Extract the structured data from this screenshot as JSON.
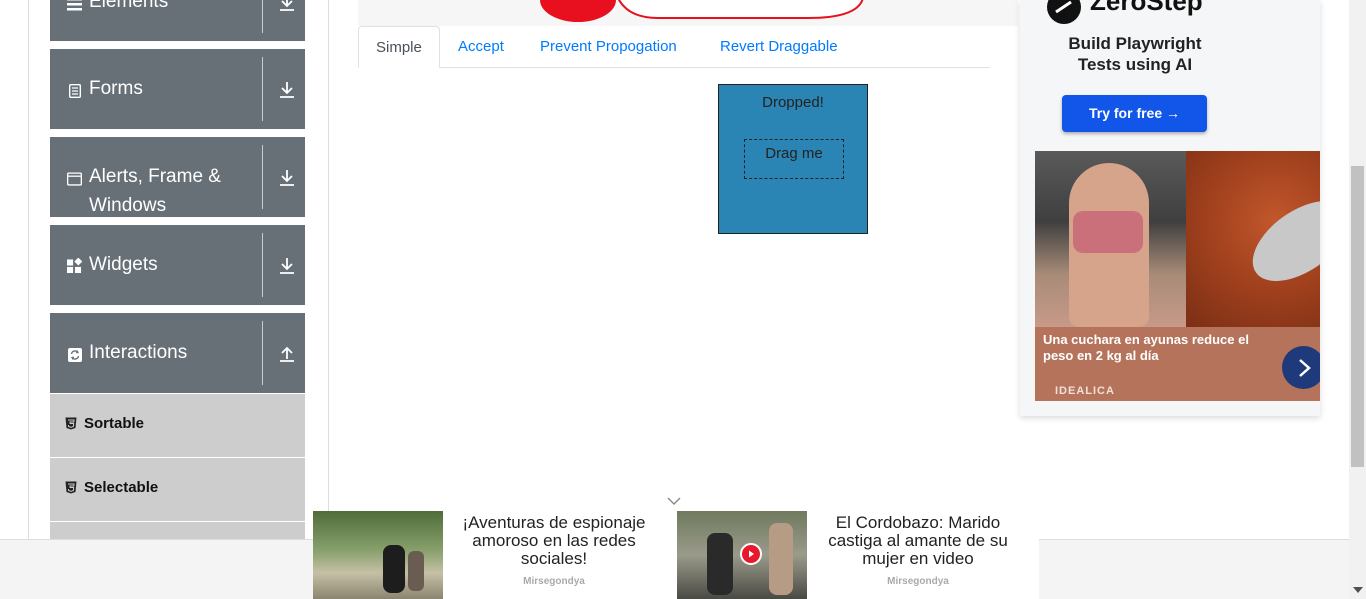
{
  "sidebar": {
    "groups": [
      {
        "label": "Elements",
        "icon": "menu-icon",
        "state": "collapsed"
      },
      {
        "label": "Forms",
        "icon": "document-icon",
        "state": "collapsed"
      },
      {
        "label": "Alerts, Frame &",
        "label2": "Windows",
        "icon": "window-icon",
        "state": "collapsed"
      },
      {
        "label": "Widgets",
        "icon": "widgets-icon",
        "state": "collapsed"
      },
      {
        "label": "Interactions",
        "icon": "refresh-icon",
        "state": "expanded"
      }
    ],
    "sub_items": [
      {
        "label": "Sortable",
        "icon": "html5-icon"
      },
      {
        "label": "Selectable",
        "icon": "html5-icon"
      }
    ]
  },
  "tabs": [
    {
      "label": "Simple",
      "active": true
    },
    {
      "label": "Accept",
      "active": false
    },
    {
      "label": "Prevent Propogation",
      "active": false
    },
    {
      "label": "Revert Draggable",
      "active": false
    }
  ],
  "droppable": {
    "status_text": "Dropped!",
    "drag_text": "Drag me",
    "color": "#2a85b4"
  },
  "right_ad": {
    "brand": "ZeroStep",
    "headline_line1": "Build Playwright",
    "headline_line2": "Tests using AI",
    "cta": "Try for free →",
    "cta_color": "#1156e8",
    "promo_text": "Una cuchara en ayunas reduce el peso en 2 kg al día",
    "promo_source": "IDEALICA"
  },
  "bottom_ad": {
    "items": [
      {
        "text": "¡Aventuras de espionaje amoroso en las redes sociales!",
        "source": "Mirsegondya"
      },
      {
        "text": "El Cordobazo: Marido castiga al amante de su mujer en video",
        "source": "Mirsegondya"
      }
    ]
  }
}
